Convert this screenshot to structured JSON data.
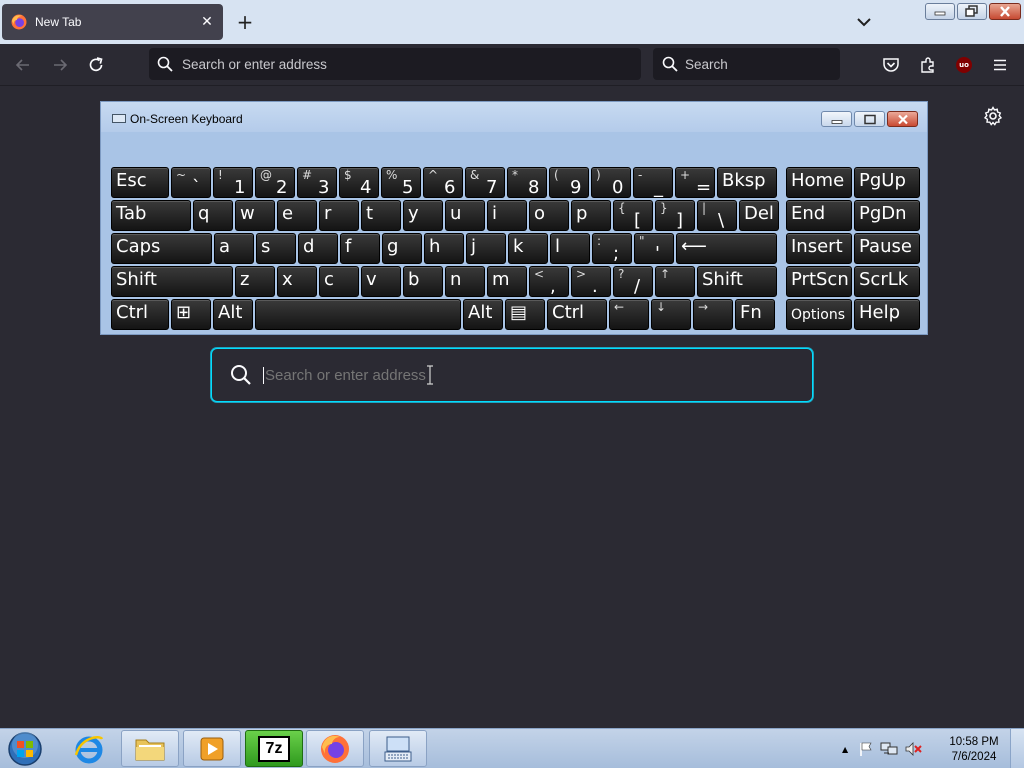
{
  "browser": {
    "tab_title": "New Tab",
    "tab_close": "✕",
    "new_tab": "+",
    "url_placeholder": "Search or enter address",
    "search_placeholder": "Search",
    "ublock_label": "uo"
  },
  "osk": {
    "title": "On-Screen Keyboard",
    "rows": [
      [
        {
          "main": "Esc",
          "w": 0
        },
        {
          "sub": "~",
          "low": "`"
        },
        {
          "sub": "!",
          "low": "1"
        },
        {
          "sub": "@",
          "low": "2"
        },
        {
          "sub": "#",
          "low": "3"
        },
        {
          "sub": "$",
          "low": "4"
        },
        {
          "sub": "%",
          "low": "5"
        },
        {
          "sub": "^",
          "low": "6"
        },
        {
          "sub": "&",
          "low": "7"
        },
        {
          "sub": "*",
          "low": "8"
        },
        {
          "sub": "(",
          "low": "9"
        },
        {
          "sub": ")",
          "low": "0"
        },
        {
          "sub": "-",
          "low": "_"
        },
        {
          "sub": "+",
          "low": "="
        },
        {
          "main": "Bksp"
        },
        {
          "main": "Home"
        },
        {
          "main": "PgUp"
        }
      ],
      [
        {
          "main": "Tab"
        },
        {
          "main": "q"
        },
        {
          "main": "w"
        },
        {
          "main": "e"
        },
        {
          "main": "r"
        },
        {
          "main": "t"
        },
        {
          "main": "y"
        },
        {
          "main": "u"
        },
        {
          "main": "i"
        },
        {
          "main": "o"
        },
        {
          "main": "p"
        },
        {
          "sub": "{",
          "low": "["
        },
        {
          "sub": "}",
          "low": "]"
        },
        {
          "sub": "|",
          "low": "\\"
        },
        {
          "main": "Del"
        },
        {
          "main": "End"
        },
        {
          "main": "PgDn"
        }
      ],
      [
        {
          "main": "Caps"
        },
        {
          "main": "a"
        },
        {
          "main": "s"
        },
        {
          "main": "d"
        },
        {
          "main": "f"
        },
        {
          "main": "g"
        },
        {
          "main": "h"
        },
        {
          "main": "j"
        },
        {
          "main": "k"
        },
        {
          "main": "l"
        },
        {
          "sub": ":",
          "low": ";"
        },
        {
          "sub": "\"",
          "low": "'"
        },
        {
          "main": "⟵"
        },
        {
          "main": "Insert"
        },
        {
          "main": "Pause"
        }
      ],
      [
        {
          "main": "Shift"
        },
        {
          "main": "z"
        },
        {
          "main": "x"
        },
        {
          "main": "c"
        },
        {
          "main": "v"
        },
        {
          "main": "b"
        },
        {
          "main": "n"
        },
        {
          "main": "m"
        },
        {
          "sub": "<",
          "low": ","
        },
        {
          "sub": ">",
          "low": "."
        },
        {
          "sub": "?",
          "low": "/"
        },
        {
          "sub": "↑",
          "low": ""
        },
        {
          "main": "Shift"
        },
        {
          "main": "PrtScn"
        },
        {
          "main": "ScrLk"
        }
      ],
      [
        {
          "main": "Ctrl"
        },
        {
          "main": "⊞"
        },
        {
          "main": "Alt"
        },
        {
          "main": ""
        },
        {
          "main": "Alt"
        },
        {
          "main": "▤"
        },
        {
          "main": "Ctrl"
        },
        {
          "sub": "←",
          "low": ""
        },
        {
          "sub": "↓",
          "low": ""
        },
        {
          "sub": "→",
          "low": ""
        },
        {
          "main": "Fn"
        },
        {
          "main": "Options",
          "small": true
        },
        {
          "main": "Help"
        }
      ]
    ]
  },
  "center_search": {
    "placeholder": "Search or enter address"
  },
  "taskbar": {
    "time": "10:58 PM",
    "date": "7/6/2024",
    "seven_zip_label": "7z",
    "tray_chevron": "▲"
  }
}
